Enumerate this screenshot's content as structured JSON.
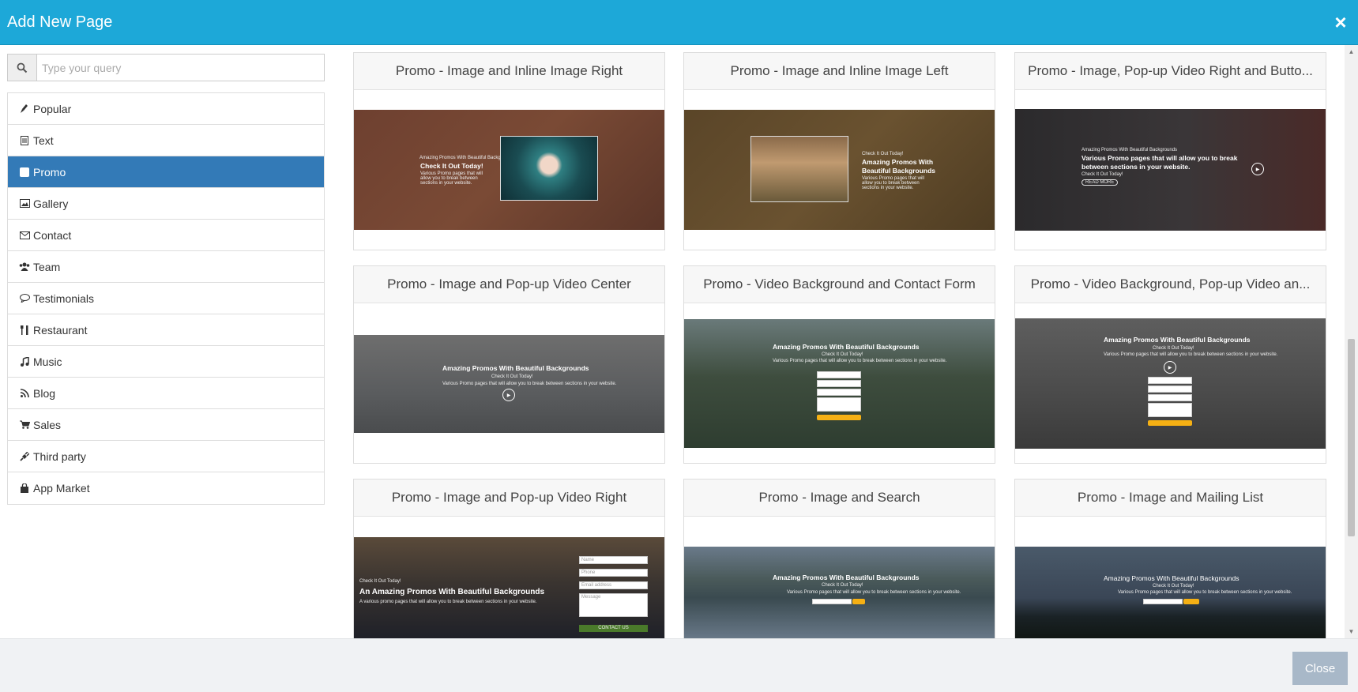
{
  "header": {
    "title": "Add New Page",
    "close_icon": "×"
  },
  "search": {
    "placeholder": "Type your query"
  },
  "categories": [
    {
      "label": "Popular"
    },
    {
      "label": "Text"
    },
    {
      "label": "Promo"
    },
    {
      "label": "Gallery"
    },
    {
      "label": "Contact"
    },
    {
      "label": "Team"
    },
    {
      "label": "Testimonials"
    },
    {
      "label": "Restaurant"
    },
    {
      "label": "Music"
    },
    {
      "label": "Blog"
    },
    {
      "label": "Sales"
    },
    {
      "label": "Third party"
    },
    {
      "label": "App Market"
    }
  ],
  "templates": [
    {
      "title": "Promo - Image and Inline Image Right"
    },
    {
      "title": "Promo - Image and Inline Image Left"
    },
    {
      "title": "Promo - Image, Pop-up Video Right and Butto..."
    },
    {
      "title": "Promo - Image and Pop-up Video Center"
    },
    {
      "title": "Promo - Video Background and Contact Form"
    },
    {
      "title": "Promo - Video Background, Pop-up Video an..."
    },
    {
      "title": "Promo - Image and Pop-up Video Right"
    },
    {
      "title": "Promo - Image and Search"
    },
    {
      "title": "Promo - Image and Mailing List"
    }
  ],
  "thumb_text": {
    "small_heading": "Amazing Promos With Beautiful Backgrounds",
    "check_it": "Check It Out Today!",
    "amazing": "Amazing Promos With Beautiful Backgrounds",
    "amazing_two_line_1": "Amazing Promos With",
    "amazing_two_line_2": "Beautiful Backgrounds",
    "various": "Various Promo pages that will allow you to break between sections in your website.",
    "various_two_line_1": "Various Promo pages that will allow you to break",
    "various_two_line_2": "between sections in your website.",
    "an_amazing": "An Amazing Promos With Beautiful Backgrounds",
    "a_various": "A various promo pages that will allow you to break between sections in your website.",
    "read_more": "READ MORE",
    "contact_us": "CONTACT US",
    "name": "Name",
    "phone": "Phone",
    "email": "Email address",
    "message": "Message"
  },
  "footer": {
    "close_label": "Close"
  },
  "colors": {
    "header_bg": "#1da8d8",
    "active_bg": "#337ab7",
    "close_btn_bg": "#a8b8c8"
  }
}
